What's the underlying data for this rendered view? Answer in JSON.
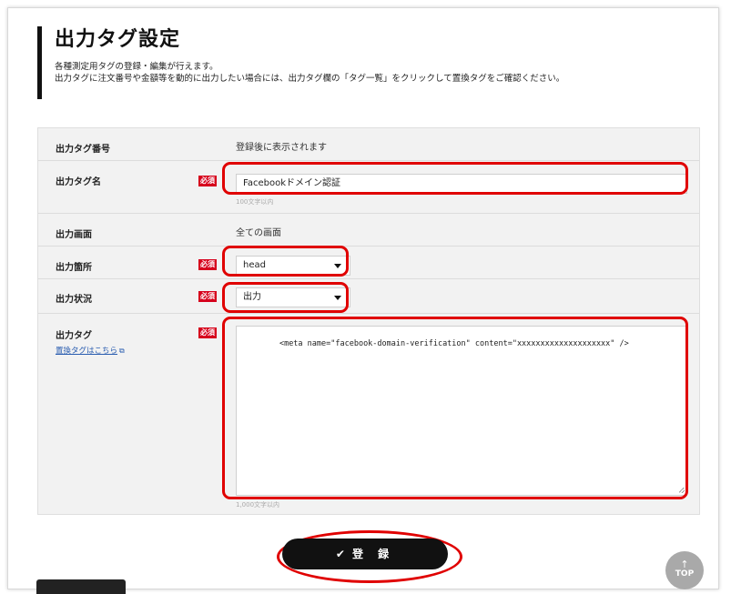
{
  "header": {
    "title": "出力タグ設定",
    "desc_line1": "各種測定用タグの登録・編集が行えます。",
    "desc_line2": "出力タグに注文番号や金額等を動的に出力したい場合には、出力タグ欄の「タグ一覧」をクリックして置換タグをご確認ください。"
  },
  "form": {
    "required_label": "必須",
    "tag_number": {
      "label": "出力タグ番号",
      "value": "登録後に表示されます"
    },
    "tag_name": {
      "label": "出力タグ名",
      "value": "Facebookドメイン認証",
      "hint": "100文字以内"
    },
    "screen": {
      "label": "出力画面",
      "value": "全ての画面"
    },
    "location": {
      "label": "出力箇所",
      "selected": "head"
    },
    "status": {
      "label": "出力状況",
      "selected": "出力"
    },
    "tag": {
      "label": "出力タグ",
      "link": "置換タグはこちら",
      "value": "<meta name=\"facebook-domain-verification\" content=\"xxxxxxxxxxxxxxxxxxxx\" />",
      "hint": "1,000文字以内"
    }
  },
  "actions": {
    "submit_label": "登 録",
    "check_glyph": "✔",
    "top_arrow": "↑",
    "top_label": "TOP"
  },
  "colors": {
    "required_bg": "#d6001c",
    "highlight": "#e00000",
    "button_bg": "#111111"
  },
  "icons": {
    "submit": "check-icon",
    "tag_link": "external-link-icon",
    "dropdown": "chevron-down-icon"
  }
}
